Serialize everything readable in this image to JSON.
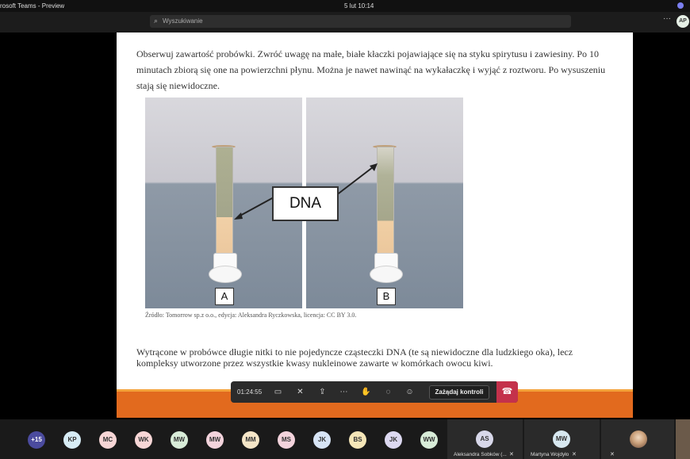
{
  "titlebar": {
    "app": "rosoft Teams - Preview",
    "clock": "5 lut  10:14"
  },
  "toolbar": {
    "search_placeholder": "Wyszukiwanie",
    "more": "···",
    "me_initials": "AP"
  },
  "slide": {
    "paragraph1": "Obserwuj zawartość probówki. Zwróć uwagę na małe, białe kłaczki pojawiające się na styku spirytusu i zawiesiny. Po 10 minutach zbiorą się one na powierzchni płynu. Można je nawet nawinąć na wykałaczkę i wyjąć z roztworu. Po wysuszeniu stają się niewidoczne.",
    "dna_label": "DNA",
    "panel_a": "A",
    "panel_b": "B",
    "source": "Źródło: Tomorrow sp.z o.o., edycja: Aleksandra Ryczkowska, licencja: CC BY 3.0.",
    "paragraph2": "Wytrącone w probówce długie nitki to nie pojedyncze cząsteczki DNA (te są niewidoczne dla ludzkiego oka), lecz kompleksy utworzone przez wszystkie kwasy nukleinowe zawarte w komórkach owocu kiwi."
  },
  "callbar": {
    "timer": "01:24:55",
    "control_label": "Zażądaj kontroli"
  },
  "gallery": {
    "overflow": "+15",
    "avatars": [
      {
        "initials": "KP",
        "color": "#d7ecf5"
      },
      {
        "initials": "MC",
        "color": "#f7d6d6"
      },
      {
        "initials": "WK",
        "color": "#f7d6d6"
      },
      {
        "initials": "MW",
        "color": "#d8ecd8"
      },
      {
        "initials": "MW",
        "color": "#f3d3dc"
      },
      {
        "initials": "MM",
        "color": "#f5e6c8"
      },
      {
        "initials": "MS",
        "color": "#f3d3dc"
      },
      {
        "initials": "JK",
        "color": "#d7e4f5"
      },
      {
        "initials": "BS",
        "color": "#f5e6b8"
      },
      {
        "initials": "JK",
        "color": "#dcd8f0"
      },
      {
        "initials": "WW",
        "color": "#d8ecd8"
      }
    ],
    "tiles": [
      {
        "initials": "AS",
        "name": "Aleksandra Sobków (..."
      },
      {
        "initials": "MW",
        "name": "Martyna Wojdyło"
      }
    ]
  }
}
